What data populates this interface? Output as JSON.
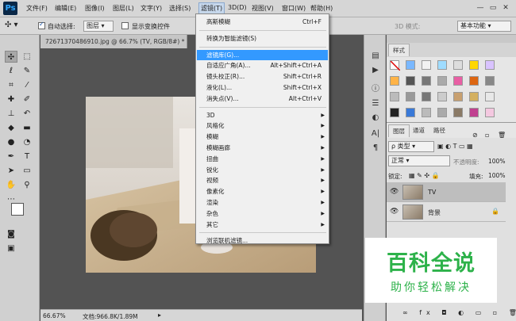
{
  "app": {
    "logo": "Ps"
  },
  "menubar": {
    "items": [
      "文件(F)",
      "编辑(E)",
      "图像(I)",
      "图层(L)",
      "文字(Y)",
      "选择(S)",
      "滤镜(T)",
      "3D(D)",
      "视图(V)",
      "窗口(W)",
      "帮助(H)"
    ],
    "active_index": 6,
    "window_buttons": [
      "—",
      "▭",
      "✕"
    ]
  },
  "options_bar": {
    "auto_select_label": "自动选择:",
    "auto_select_value": "图层",
    "show_transform_label": "显示变换控件",
    "mode_3d_label": "3D 模式:",
    "workspace": "基本功能"
  },
  "document": {
    "tab_title": "72671370486910.jpg @ 66.7% (TV, RGB/8#) *",
    "zoom": "66.67%",
    "doc_size": "文档:966.8K/1.89M"
  },
  "filter_menu": {
    "items": [
      {
        "label": "高斯模糊",
        "shortcut": "Ctrl+F",
        "submenu": false,
        "highlighted": false
      },
      {
        "sep": true
      },
      {
        "label": "转换为智能滤镜(S)",
        "shortcut": "",
        "submenu": false,
        "highlighted": false
      },
      {
        "sep": true
      },
      {
        "label": "滤镜库(G)...",
        "shortcut": "",
        "submenu": false,
        "highlighted": true
      },
      {
        "label": "自适应广角(A)...",
        "shortcut": "Alt+Shift+Ctrl+A",
        "submenu": false,
        "highlighted": false
      },
      {
        "label": "镜头校正(R)...",
        "shortcut": "Shift+Ctrl+R",
        "submenu": false,
        "highlighted": false
      },
      {
        "label": "液化(L)...",
        "shortcut": "Shift+Ctrl+X",
        "submenu": false,
        "highlighted": false
      },
      {
        "label": "消失点(V)...",
        "shortcut": "Alt+Ctrl+V",
        "submenu": false,
        "highlighted": false
      },
      {
        "sep": true
      },
      {
        "label": "3D",
        "shortcut": "",
        "submenu": true,
        "highlighted": false
      },
      {
        "label": "风格化",
        "shortcut": "",
        "submenu": true,
        "highlighted": false
      },
      {
        "label": "模糊",
        "shortcut": "",
        "submenu": true,
        "highlighted": false
      },
      {
        "label": "模糊画廊",
        "shortcut": "",
        "submenu": true,
        "highlighted": false
      },
      {
        "label": "扭曲",
        "shortcut": "",
        "submenu": true,
        "highlighted": false
      },
      {
        "label": "锐化",
        "shortcut": "",
        "submenu": true,
        "highlighted": false
      },
      {
        "label": "视频",
        "shortcut": "",
        "submenu": true,
        "highlighted": false
      },
      {
        "label": "像素化",
        "shortcut": "",
        "submenu": true,
        "highlighted": false
      },
      {
        "label": "渲染",
        "shortcut": "",
        "submenu": true,
        "highlighted": false
      },
      {
        "label": "杂色",
        "shortcut": "",
        "submenu": true,
        "highlighted": false
      },
      {
        "label": "其它",
        "shortcut": "",
        "submenu": true,
        "highlighted": false
      },
      {
        "sep": true
      },
      {
        "label": "浏览联机滤镜...",
        "shortcut": "",
        "submenu": false,
        "highlighted": false
      }
    ]
  },
  "styles_panel": {
    "tab": "样式"
  },
  "layers_panel": {
    "tabs": [
      "图层",
      "通道",
      "路径"
    ],
    "filter_label": "ρ 类型",
    "blend_mode": "正常",
    "opacity_label": "不透明度:",
    "opacity_value": "100%",
    "lock_label": "锁定:",
    "fill_label": "填充:",
    "fill_value": "100%",
    "layers": [
      {
        "name": "TV",
        "selected": true,
        "locked": false
      },
      {
        "name": "背景",
        "selected": false,
        "locked": true
      }
    ]
  },
  "watermark": {
    "title": "百科全说",
    "subtitle": "助你轻松解决"
  },
  "colors": {
    "highlight": "#3399ff",
    "watermark_green": "#2db24a"
  }
}
